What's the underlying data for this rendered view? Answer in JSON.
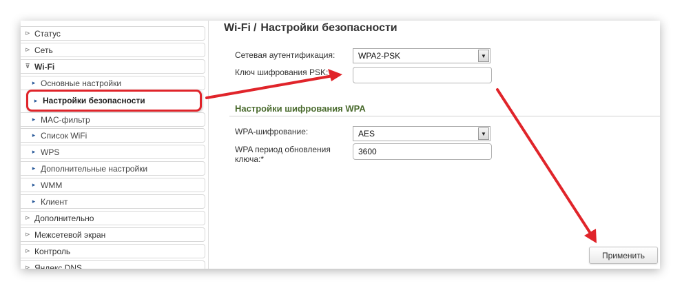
{
  "sidebar": {
    "items": [
      {
        "label": "Статус"
      },
      {
        "label": "Сеть"
      },
      {
        "label": "Wi-Fi"
      },
      {
        "label": "Основные настройки"
      },
      {
        "label": "Настройки безопасности"
      },
      {
        "label": "MAC-фильтр"
      },
      {
        "label": "Список WiFi"
      },
      {
        "label": "WPS"
      },
      {
        "label": "Дополнительные настройки"
      },
      {
        "label": "WMM"
      },
      {
        "label": "Клиент"
      },
      {
        "label": "Дополнительно"
      },
      {
        "label": "Межсетевой экран"
      },
      {
        "label": "Контроль"
      },
      {
        "label": "Яндекс.DNS"
      }
    ]
  },
  "page": {
    "breadcrumb_root": "Wi-Fi",
    "separator": "/",
    "title": "Настройки безопасности"
  },
  "form": {
    "auth_label": "Сетевая аутентификация:",
    "auth_value": "WPA2-PSK",
    "psk_label": "Ключ шифрования PSK:",
    "psk_value": "",
    "wpa_section_title": "Настройки шифрования WPA",
    "wpa_cipher_label": "WPA-шифрование:",
    "wpa_cipher_value": "AES",
    "wpa_period_label_line1": "WPA период обновления",
    "wpa_period_label_line2": "ключа:*",
    "wpa_period_value": "3600"
  },
  "actions": {
    "apply_label": "Применить"
  },
  "colors": {
    "annotation_red": "#e0242a",
    "section_green": "#4a6b2e",
    "sub_marker_blue": "#2a5a9a"
  },
  "icons": {
    "collapsed_marker": "circle-chevron-right",
    "expanded_marker": "circle-chevron-down",
    "sub_marker": "small-triangle-right",
    "dropdown": "chevron-down"
  }
}
